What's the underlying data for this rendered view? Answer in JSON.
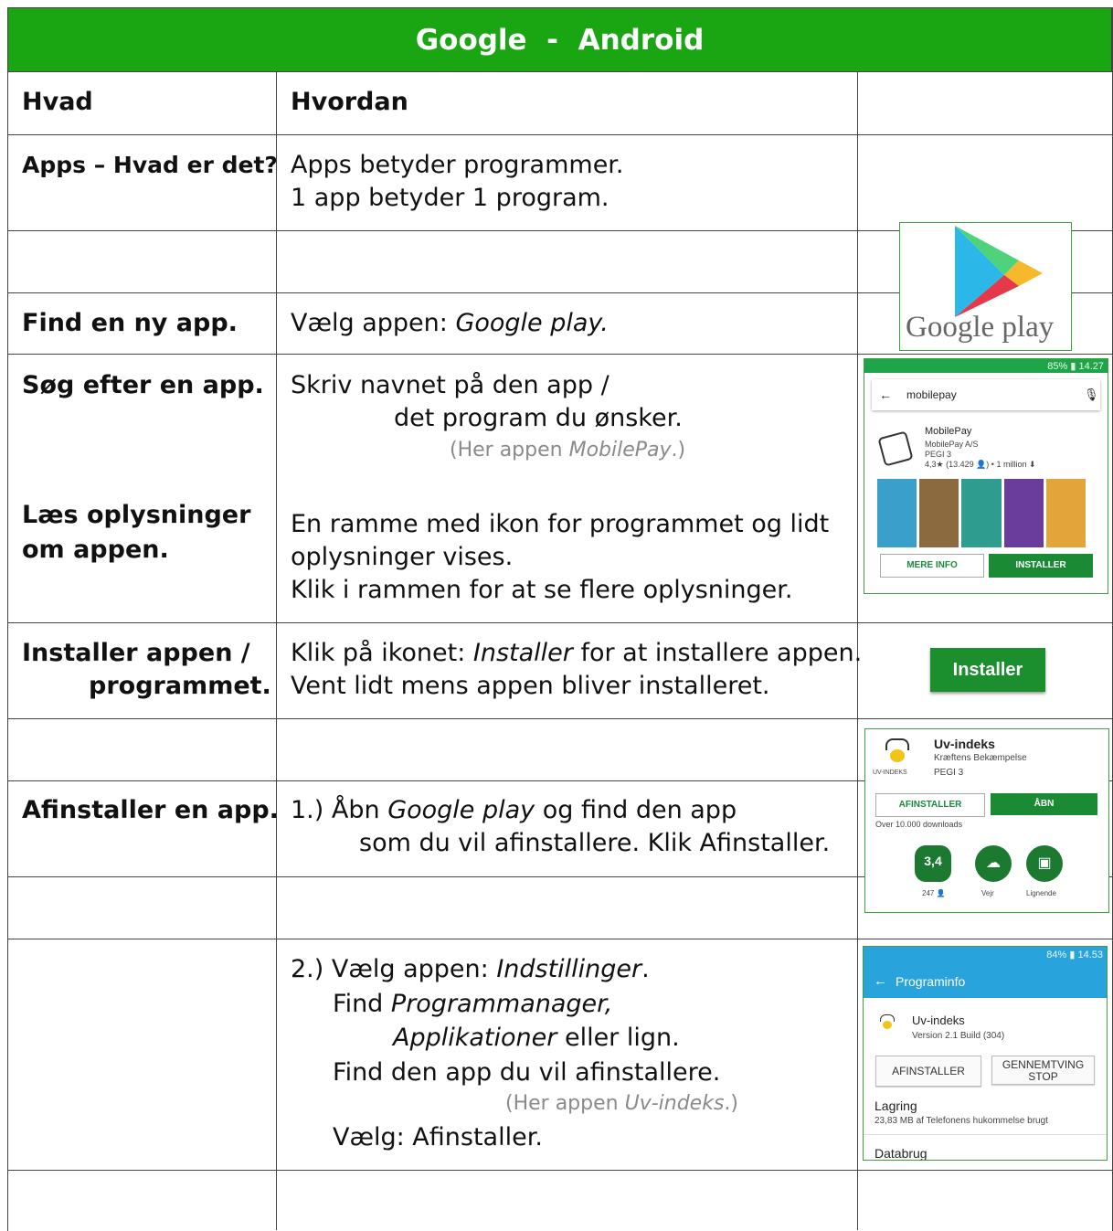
{
  "header": {
    "title": "Google  -  Android"
  },
  "columns": {
    "what": "Hvad",
    "how": "Hvordan"
  },
  "rows": {
    "apps": {
      "what": "Apps – Hvad er det?",
      "how_line1": "Apps betyder programmer.",
      "how_line2": "1 app betyder 1 program."
    },
    "find": {
      "what": "Find en ny app.",
      "how_prefix": "Vælg appen: ",
      "how_italic": "Google play."
    },
    "search": {
      "what": "Søg efter en app.",
      "how_line1": "Skriv navnet på den app /",
      "how_line2": "det program du ønsker.",
      "note_prefix": "(Her appen ",
      "note_italic": "MobilePay",
      "note_suffix": ".)"
    },
    "read": {
      "what_line1": "Læs oplysninger",
      "what_line2": "om appen.",
      "how_line1": "En ramme med ikon for programmet og lidt",
      "how_line2": "oplysninger vises.",
      "how_line3": "Klik i rammen for at se flere oplysninger."
    },
    "install": {
      "what_line1": "Installer appen /",
      "what_line2": "programmet.",
      "how_prefix": "Klik på ikonet: ",
      "how_italic": "Installer",
      "how_suffix": " for at installere appen.",
      "how_line2": "Vent lidt mens appen bliver installeret.",
      "button_label": "Installer"
    },
    "uninstall": {
      "what": "Afinstaller en app.",
      "how_prefix": "1.) Åbn ",
      "how_italic": "Google play",
      "how_suffix": " og find den app",
      "how_line2": "som du vil afinstallere. Klik Afinstaller."
    },
    "settings": {
      "line1_prefix": "2.) Vælg appen: ",
      "line1_italic": "Indstillinger",
      "line1_suffix": ".",
      "line2_prefix": "Find ",
      "line2_italic": "Programmanager,",
      "line3_italic": "Applikationer",
      "line3_suffix": " eller lign.",
      "line4": "Find den app du vil afinstallere.",
      "note_prefix": "(Her appen ",
      "note_italic": "Uv-indeks",
      "note_suffix": ".)",
      "line5": "Vælg: Afinstaller."
    }
  },
  "google_play_logo": {
    "text": "Google play"
  },
  "mobilepay_shot": {
    "status": "85% ▮ 14.27",
    "search_text": "mobilepay",
    "app_name": "MobilePay",
    "developer": "MobilePay A/S",
    "pegi": "PEGI 3",
    "rating_line": "4,3★ (13.429 👤) • 1 million ⬇",
    "more_info": "MERE INFO",
    "install": "INSTALLER"
  },
  "uv_shot": {
    "app_name": "Uv-indeks",
    "developer": "Kræftens Bekæmpelse",
    "pegi": "PEGI 3",
    "logo_caption": "UV-INDEKS",
    "uninstall": "AFINSTALLER",
    "open": "ÅBN",
    "downloads": "Over 10.000 downloads",
    "rating": "3,4",
    "rating_count": "247 👤",
    "weather": "Vejr",
    "similar": "Lignende"
  },
  "programinfo_shot": {
    "status": "84% ▮ 14.53",
    "title": "Programinfo",
    "app_name": "Uv-indeks",
    "version": "Version 2.1 Build (304)",
    "uninstall": "AFINSTALLER",
    "force_stop_line1": "GENNEMTVING",
    "force_stop_line2": "STOP",
    "storage_title": "Lagring",
    "storage_detail": "23,83 MB af Telefonens hukommelse brugt",
    "data_title": "Databrug"
  },
  "colors": {
    "header_green": "#1aa512",
    "play_green": "#1b8a34",
    "settings_blue": "#29a3dc"
  }
}
